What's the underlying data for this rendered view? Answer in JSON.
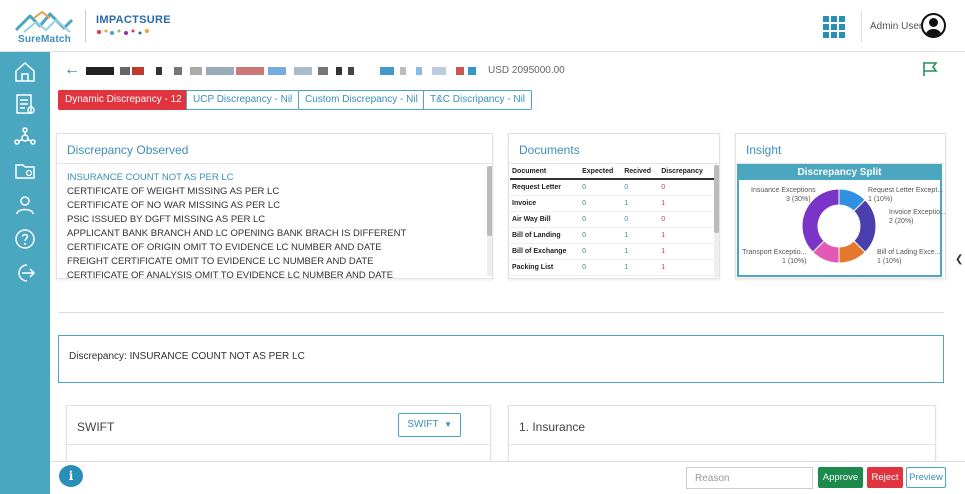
{
  "header": {
    "brand_left": "SureMatch",
    "brand_right": "IMPACTSURE",
    "user_name": "Admin User",
    "apps_icon": "grid-apps-icon"
  },
  "sidebar": {
    "items": [
      {
        "icon": "home-icon"
      },
      {
        "icon": "document-list-icon"
      },
      {
        "icon": "network-icon"
      },
      {
        "icon": "folder-icon"
      },
      {
        "icon": "user-icon"
      },
      {
        "icon": "help-icon"
      },
      {
        "icon": "logout-icon"
      }
    ]
  },
  "transaction": {
    "amount": "USD 2095000.00"
  },
  "pills": {
    "dynamic": "Dynamic Discrepancy - 12",
    "ucp": "UCP Discrepancy - Nil",
    "custom": "Custom Discrepancy - Nil",
    "tc": "T&C Discripancy - Nil"
  },
  "discrepancy_observed": {
    "title": "Discrepancy Observed",
    "items": [
      "INSURANCE COUNT NOT AS PER LC",
      "CERTIFICATE OF WEIGHT MISSING AS PER LC",
      "CERTIFICATE OF NO WAR MISSING AS PER LC",
      "PSIC ISSUED BY DGFT MISSING AS PER LC",
      "APPLICANT BANK BRANCH AND LC OPENING BANK BRACH IS DIFFERENT",
      "CERTIFICATE OF ORIGIN OMIT TO EVIDENCE LC NUMBER AND DATE",
      "FREIGHT CERTIFICATE OMIT TO EVIDENCE LC NUMBER AND DATE",
      "CERTIFICATE OF ANALYSIS OMIT TO EVIDENCE LC NUMBER AND DATE"
    ]
  },
  "documents": {
    "title": "Documents",
    "columns": [
      "Document",
      "Expected",
      "Recived",
      "Discrepancy"
    ],
    "rows": [
      [
        "Request Letter",
        "0",
        "0",
        "0"
      ],
      [
        "Invoice",
        "0",
        "1",
        "1"
      ],
      [
        "Air Way Bill",
        "0",
        "0",
        "0"
      ],
      [
        "Bill of Landing",
        "0",
        "1",
        "1"
      ],
      [
        "Bill of Exchange",
        "0",
        "1",
        "1"
      ],
      [
        "Packing List",
        "0",
        "1",
        "1"
      ]
    ]
  },
  "insight": {
    "title": "Insight"
  },
  "chart_data": {
    "type": "pie",
    "title": "Discrepancy Split",
    "categories": [
      "Request Letter Except...",
      "Invoice Exceptio...",
      "Bill of Lading Exce...",
      "Transport Exceptio...",
      "Insuance Exceptions"
    ],
    "values": [
      1,
      2,
      1,
      1,
      3
    ],
    "value_labels": [
      "1 (10%)",
      "2 (20%)",
      "1 (10%)",
      "1 (10%)",
      "3 (30%)"
    ],
    "colors": [
      "#2f8fe0",
      "#4b3fae",
      "#e6782d",
      "#e25ab5",
      "#7a35c8"
    ]
  },
  "selected_discrepancy": {
    "label": "Discrepancy: INSURANCE COUNT NOT AS PER LC"
  },
  "swift_panel": {
    "title": "SWIFT",
    "dropdown": "SWIFT"
  },
  "insurance_panel": {
    "title": "1. Insurance"
  },
  "footer": {
    "reason_placeholder": "Reason",
    "approve": "Approve",
    "reject": "Reject",
    "preview": "Preview"
  }
}
